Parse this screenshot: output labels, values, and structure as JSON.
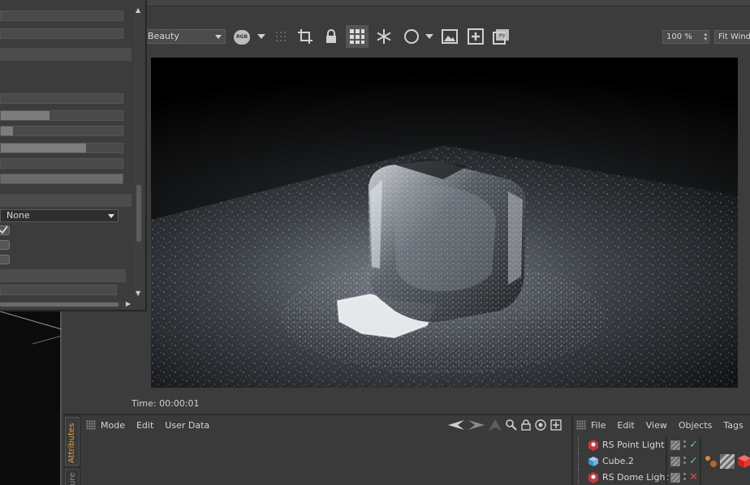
{
  "render_view": {
    "aov": "Beauty",
    "rgb_label": "RGB",
    "zoom": "100 %",
    "fit_button": "Fit Wind",
    "time_label": "Time: 00:00:01"
  },
  "settings_panel": {
    "dropdown_value": "None"
  },
  "attributes": {
    "tab_label": "Attributes",
    "second_tab_label": "ure",
    "menu": [
      "Mode",
      "Edit",
      "User Data"
    ]
  },
  "objects": {
    "menu": [
      "File",
      "Edit",
      "View",
      "Objects",
      "Tags"
    ],
    "rows": [
      {
        "name": "RS Point Light",
        "icon": "rs-light-icon",
        "state": "✓",
        "state_color": "#5fc85f"
      },
      {
        "name": "Cube.2",
        "icon": "cube-icon",
        "state": "✓",
        "state_color": "#5fc85f"
      },
      {
        "name": "RS Dome Light",
        "icon": "rs-light-icon",
        "state": "✕",
        "state_color": "#e04848"
      }
    ]
  },
  "colors": {
    "accent_tab": "#e6a23c",
    "check_green": "#5fc85f",
    "cross_red": "#e04848"
  }
}
